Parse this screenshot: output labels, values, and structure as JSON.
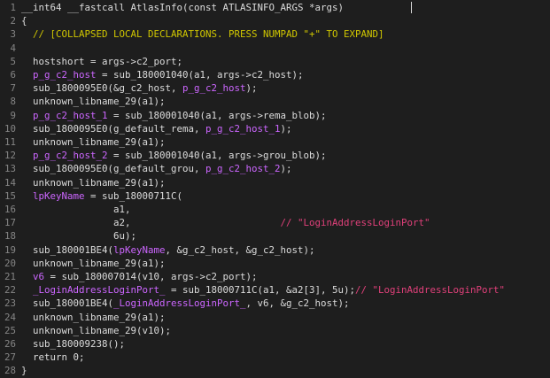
{
  "editor": {
    "lines": [
      {
        "n": "1",
        "segments": [
          {
            "t": "__int64 __fastcall AtlasInfo(const ATLASINFO_ARGS *args)",
            "c": "kw"
          }
        ]
      },
      {
        "n": "2",
        "segments": [
          {
            "t": "{",
            "c": "pn"
          }
        ]
      },
      {
        "n": "3",
        "segments": [
          {
            "t": "  // [COLLAPSED LOCAL DECLARATIONS. PRESS NUMPAD \"+\" TO EXPAND]",
            "c": "cm"
          }
        ]
      },
      {
        "n": "4",
        "segments": []
      },
      {
        "n": "5",
        "segments": [
          {
            "t": "  hostshort = args->c2_port;",
            "c": "kw"
          }
        ]
      },
      {
        "n": "6",
        "segments": [
          {
            "t": "  p_g_c2_host",
            "c": "gl"
          },
          {
            "t": " = sub_180001040(a1, args->c2_host);",
            "c": "kw"
          }
        ]
      },
      {
        "n": "7",
        "segments": [
          {
            "t": "  sub_1800095E0(&g_c2_host, ",
            "c": "kw"
          },
          {
            "t": "p_g_c2_host",
            "c": "gl"
          },
          {
            "t": ");",
            "c": "kw"
          }
        ]
      },
      {
        "n": "8",
        "segments": [
          {
            "t": "  unknown_libname_29(a1);",
            "c": "lib"
          }
        ]
      },
      {
        "n": "9",
        "segments": [
          {
            "t": "  p_g_c2_host_1",
            "c": "gl"
          },
          {
            "t": " = sub_180001040(a1, args->rema_blob);",
            "c": "kw"
          }
        ]
      },
      {
        "n": "10",
        "segments": [
          {
            "t": "  sub_1800095E0(g_default_rema, ",
            "c": "kw"
          },
          {
            "t": "p_g_c2_host_1",
            "c": "gl"
          },
          {
            "t": ");",
            "c": "kw"
          }
        ]
      },
      {
        "n": "11",
        "segments": [
          {
            "t": "  unknown_libname_29(a1);",
            "c": "lib"
          }
        ]
      },
      {
        "n": "12",
        "segments": [
          {
            "t": "  p_g_c2_host_2",
            "c": "gl"
          },
          {
            "t": " = sub_180001040(a1, args->grou_blob);",
            "c": "kw"
          }
        ]
      },
      {
        "n": "13",
        "segments": [
          {
            "t": "  sub_1800095E0(g_default_grou, ",
            "c": "kw"
          },
          {
            "t": "p_g_c2_host_2",
            "c": "gl"
          },
          {
            "t": ");",
            "c": "kw"
          }
        ]
      },
      {
        "n": "14",
        "segments": [
          {
            "t": "  unknown_libname_29(a1);",
            "c": "lib"
          }
        ]
      },
      {
        "n": "15",
        "segments": [
          {
            "t": "  lpKeyName",
            "c": "gl"
          },
          {
            "t": " = sub_18000711C(",
            "c": "kw"
          }
        ]
      },
      {
        "n": "16",
        "segments": [
          {
            "t": "                a1,",
            "c": "kw"
          }
        ]
      },
      {
        "n": "17",
        "segments": [
          {
            "t": "                a2,",
            "c": "kw"
          },
          {
            "t": "                          // \"LoginAddressLoginPort\"",
            "c": "str"
          }
        ]
      },
      {
        "n": "18",
        "segments": [
          {
            "t": "                6u);",
            "c": "kw"
          }
        ]
      },
      {
        "n": "19",
        "segments": [
          {
            "t": "  sub_180001BE4(",
            "c": "kw"
          },
          {
            "t": "lpKeyName",
            "c": "gl"
          },
          {
            "t": ", &g_c2_host, &g_c2_host);",
            "c": "kw"
          }
        ]
      },
      {
        "n": "20",
        "segments": [
          {
            "t": "  unknown_libname_29(a1);",
            "c": "lib"
          }
        ]
      },
      {
        "n": "21",
        "segments": [
          {
            "t": "  v6",
            "c": "gl"
          },
          {
            "t": " = sub_180007014(v10, args->c2_port);",
            "c": "kw"
          }
        ]
      },
      {
        "n": "22",
        "segments": [
          {
            "t": "  _LoginAddressLoginPort_",
            "c": "gl"
          },
          {
            "t": " = sub_18000711C(a1, &a2[3], 5u);",
            "c": "kw"
          },
          {
            "t": "// \"LoginAddressLoginPort\"",
            "c": "str"
          }
        ]
      },
      {
        "n": "23",
        "segments": [
          {
            "t": "  sub_180001BE4(",
            "c": "kw"
          },
          {
            "t": "_LoginAddressLoginPort_",
            "c": "gl"
          },
          {
            "t": ", v6, &g_c2_host);",
            "c": "kw"
          }
        ]
      },
      {
        "n": "24",
        "segments": [
          {
            "t": "  unknown_libname_29(a1);",
            "c": "lib"
          }
        ]
      },
      {
        "n": "25",
        "segments": [
          {
            "t": "  unknown_libname_29(v10);",
            "c": "lib"
          }
        ]
      },
      {
        "n": "26",
        "segments": [
          {
            "t": "  sub_180009238();",
            "c": "kw"
          }
        ]
      },
      {
        "n": "27",
        "segments": [
          {
            "t": "  return 0;",
            "c": "kw"
          }
        ]
      },
      {
        "n": "28",
        "segments": [
          {
            "t": "}",
            "c": "pn"
          }
        ]
      }
    ]
  }
}
